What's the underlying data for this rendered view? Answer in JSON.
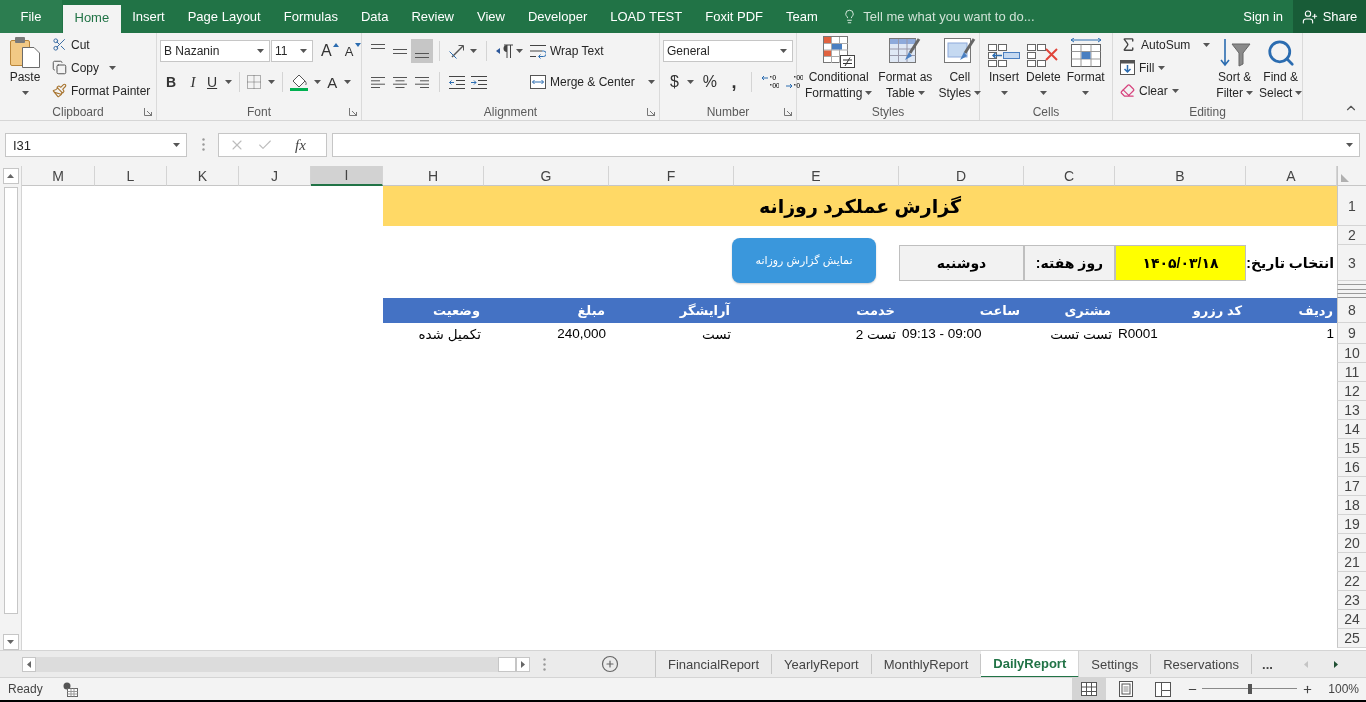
{
  "ribbon_tabs": [
    {
      "label": "File",
      "kind": "file",
      "selected": false
    },
    {
      "label": "Home",
      "kind": "tab",
      "selected": true
    },
    {
      "label": "Insert",
      "kind": "tab",
      "selected": false
    },
    {
      "label": "Page Layout",
      "kind": "tab",
      "selected": false
    },
    {
      "label": "Formulas",
      "kind": "tab",
      "selected": false
    },
    {
      "label": "Data",
      "kind": "tab",
      "selected": false
    },
    {
      "label": "Review",
      "kind": "tab",
      "selected": false
    },
    {
      "label": "View",
      "kind": "tab",
      "selected": false
    },
    {
      "label": "Developer",
      "kind": "tab",
      "selected": false
    },
    {
      "label": "LOAD TEST",
      "kind": "tab",
      "selected": false
    },
    {
      "label": "Foxit PDF",
      "kind": "tab",
      "selected": false
    },
    {
      "label": "Team",
      "kind": "tab",
      "selected": false
    }
  ],
  "tell_me": {
    "placeholder": "Tell me what you want to do..."
  },
  "account": {
    "sign_in": "Sign in",
    "share": "Share"
  },
  "ribbon": {
    "clipboard": {
      "label": "Clipboard",
      "paste": "Paste",
      "cut": "Cut",
      "copy": "Copy",
      "format_painter": "Format Painter"
    },
    "font": {
      "label": "Font",
      "font_name": "B Nazanin",
      "font_size": "11",
      "grow_font": "A",
      "shrink_font": "A",
      "bold": "B",
      "italic": "I",
      "underline": "U",
      "font_color": "A"
    },
    "alignment": {
      "label": "Alignment",
      "vertical_align": [
        {
          "kind": "top",
          "selected": false
        },
        {
          "kind": "middle",
          "selected": false
        },
        {
          "kind": "bottom",
          "selected": true
        }
      ],
      "wrap_text": "Wrap Text",
      "merge_center": "Merge & Center"
    },
    "number": {
      "label": "Number",
      "format": "General",
      "currency": "$",
      "percent": "%",
      "comma": ","
    },
    "styles": {
      "label": "Styles",
      "buttons": [
        {
          "kind": "conditional",
          "lines": [
            "Conditional",
            "Formatting"
          ]
        },
        {
          "kind": "table",
          "lines": [
            "Format as",
            "Table"
          ]
        },
        {
          "kind": "cell_styles",
          "lines": [
            "Cell",
            "Styles"
          ]
        }
      ]
    },
    "cells": {
      "label": "Cells",
      "buttons": [
        {
          "kind": "insert",
          "label": "Insert"
        },
        {
          "kind": "delete",
          "label": "Delete"
        },
        {
          "kind": "format",
          "label": "Format"
        }
      ]
    },
    "editing": {
      "label": "Editing",
      "autosum": "AutoSum",
      "fill": "Fill",
      "clear": "Clear",
      "buttons": [
        {
          "kind": "sort",
          "lines": [
            "Sort &",
            "Filter"
          ]
        },
        {
          "kind": "find",
          "lines": [
            "Find &",
            "Select"
          ]
        }
      ]
    }
  },
  "formula_bar": {
    "name_box": "I31",
    "edit_buttons": [
      {
        "kind": "cancel",
        "disabled": true
      },
      {
        "kind": "enter",
        "disabled": true
      }
    ],
    "function_label": "fx"
  },
  "sheet": {
    "columns": [
      {
        "label": "M",
        "selected": false
      },
      {
        "label": "L",
        "selected": false
      },
      {
        "label": "K",
        "selected": false
      },
      {
        "label": "J",
        "selected": false
      },
      {
        "label": "I",
        "selected": true
      },
      {
        "label": "H",
        "selected": false
      },
      {
        "label": "G",
        "selected": false
      },
      {
        "label": "F",
        "selected": false
      },
      {
        "label": "E",
        "selected": false
      },
      {
        "label": "D",
        "selected": false
      },
      {
        "label": "C",
        "selected": false
      },
      {
        "label": "B",
        "selected": false
      },
      {
        "label": "A",
        "selected": false
      }
    ],
    "rows": [
      "1",
      "2",
      "3",
      "8",
      "9",
      "10",
      "11",
      "12",
      "13",
      "14",
      "15",
      "16",
      "17",
      "18",
      "19",
      "20",
      "21",
      "22",
      "23",
      "24",
      "25"
    ],
    "title": "گزارش عملکرد روزانه",
    "date": {
      "label": "انتخاب تاریخ:",
      "value": "۱۴۰۵/۰۳/۱۸"
    },
    "weekday": {
      "label": "روز هفته:",
      "value": "دوشنبه"
    },
    "report_button": "نمایش گزارش روزانه",
    "table": {
      "columns": [
        "وضعیت",
        "مبلغ",
        "آرایشگر",
        "خدمت",
        "ساعت",
        "مشتری",
        "کد رزرو",
        "ردیف"
      ],
      "rows": [
        [
          "تکمیل شده",
          "240,000",
          "تست",
          "تست 2",
          "09:13 - 09:00",
          "تست تست",
          "R0001",
          "1"
        ]
      ]
    }
  },
  "sheet_tabs": [
    {
      "label": "FinancialReport",
      "selected": false
    },
    {
      "label": "YearlyReport",
      "selected": false
    },
    {
      "label": "MonthlyReport",
      "selected": false
    },
    {
      "label": "DailyReport",
      "selected": true
    },
    {
      "label": "Settings",
      "selected": false
    },
    {
      "label": "Reservations",
      "selected": false
    }
  ],
  "more_tabs": "...",
  "sheet_navigation": [
    {
      "kind": "previous",
      "disabled": true
    },
    {
      "kind": "next",
      "disabled": false
    }
  ],
  "status_bar": {
    "status": "Ready",
    "views": [
      {
        "kind": "normal",
        "selected": true
      },
      {
        "kind": "page_layout",
        "selected": false
      },
      {
        "kind": "page_break",
        "selected": false
      }
    ],
    "zoom": {
      "level": 0.5,
      "reading": "100%"
    }
  }
}
